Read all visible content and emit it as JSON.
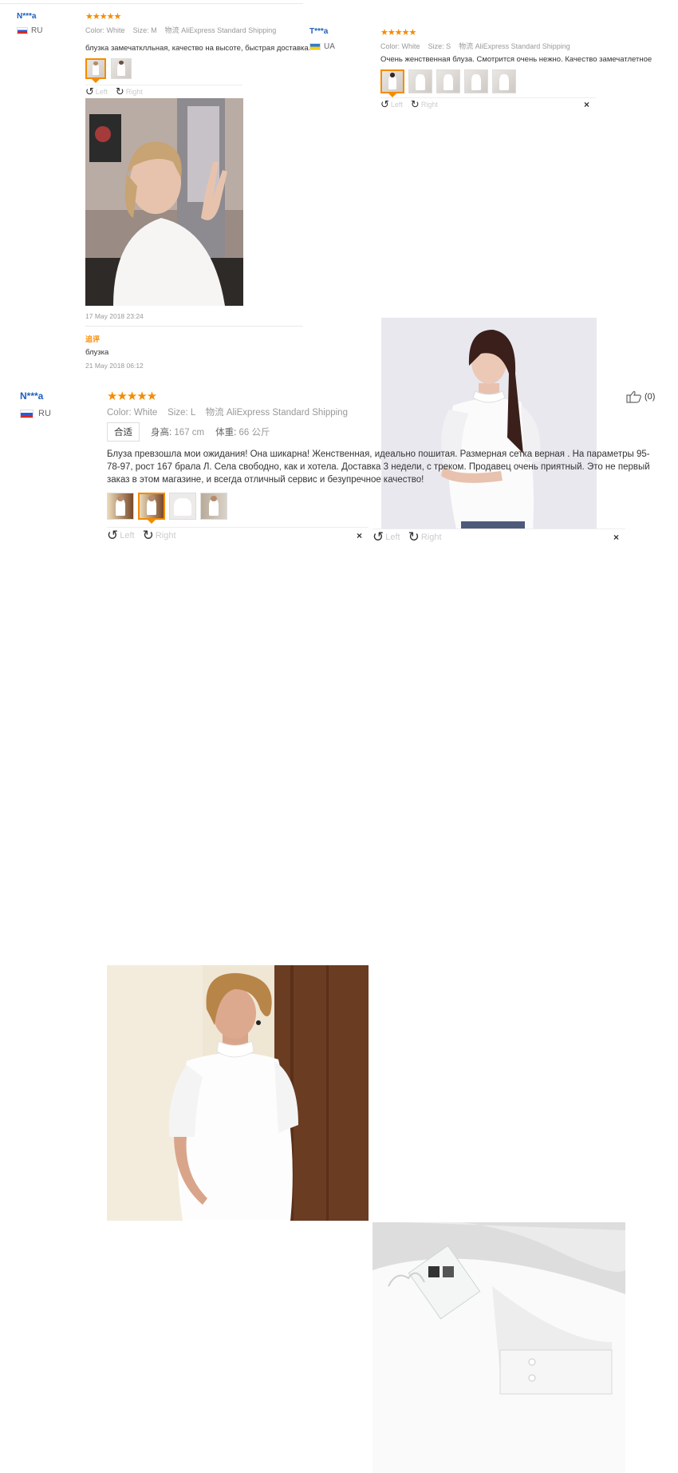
{
  "review1": {
    "user": "N***a",
    "country": "RU",
    "stars": "★★★★★",
    "color_label": "Color:",
    "color": "White",
    "size_label": "Size:",
    "size": "M",
    "logistics_label": "物流",
    "shipping": "AliExpress Standard Shipping",
    "text": "блузка замечатклльная, качество на высоте, быстрая доставка.",
    "left": "Left",
    "right": "Right",
    "date": "17 May 2018 23:24",
    "additional_label": "追评",
    "additional_text": "блузка",
    "additional_date": "21 May 2018 06:12"
  },
  "review2": {
    "user": "T***a",
    "country": "UA",
    "stars": "★★★★★",
    "color_label": "Color:",
    "color": "White",
    "size_label": "Size:",
    "size": "S",
    "logistics_label": "物流",
    "shipping": "AliExpress Standard Shipping",
    "text": "Очень женственная блуза. Смотрится очень нежно. Качество замечатлетное",
    "left": "Left",
    "right": "Right",
    "close": "×"
  },
  "review3": {
    "user": "N***a",
    "country": "RU",
    "stars": "★★★★★",
    "color_label": "Color:",
    "color": "White",
    "size_label": "Size:",
    "size": "L",
    "logistics_label": "物流",
    "shipping": "AliExpress Standard Shipping",
    "fit_tag": "合适",
    "height_label": "身高:",
    "height": "167 cm",
    "weight_label": "体重:",
    "weight": "66 公斤",
    "text": "Блуза превзошла мои ожидания! Она шикарна! Женственная, идеально пошитая. Размерная сетка верная . На параметры 95-78-97, рост 167 брала Л. Села свободно, как и хотела. Доставка 3 недели, с треком. Продавец очень приятный. Это не первый заказ в этом магазине, и всегда отличный сервис и безупречное качество!",
    "likes": "(0)",
    "left": "Left",
    "right": "Right",
    "close": "×"
  },
  "colors": {
    "accent": "#f58b00",
    "username": "#1f5fbf",
    "muted": "#999999"
  }
}
